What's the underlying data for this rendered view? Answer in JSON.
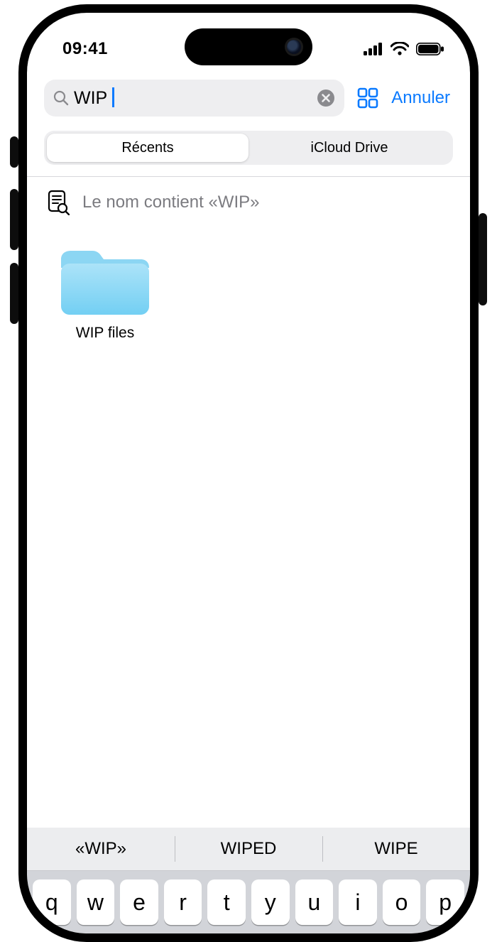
{
  "status": {
    "time": "09:41"
  },
  "search": {
    "value": "WIP",
    "cancel_label": "Annuler"
  },
  "tabs": [
    {
      "label": "Récents",
      "active": true
    },
    {
      "label": "iCloud Drive",
      "active": false
    }
  ],
  "filter": {
    "label": "Le nom contient «WIP»"
  },
  "results": [
    {
      "name": "WIP files",
      "type": "folder"
    }
  ],
  "keyboard": {
    "suggestions": [
      "«WIP»",
      "WIPED",
      "WIPE"
    ],
    "row1": [
      "q",
      "w",
      "e",
      "r",
      "t",
      "y",
      "u",
      "i",
      "o",
      "p"
    ]
  },
  "colors": {
    "accent": "#0a7aff",
    "folder": "#7fd4f5"
  }
}
